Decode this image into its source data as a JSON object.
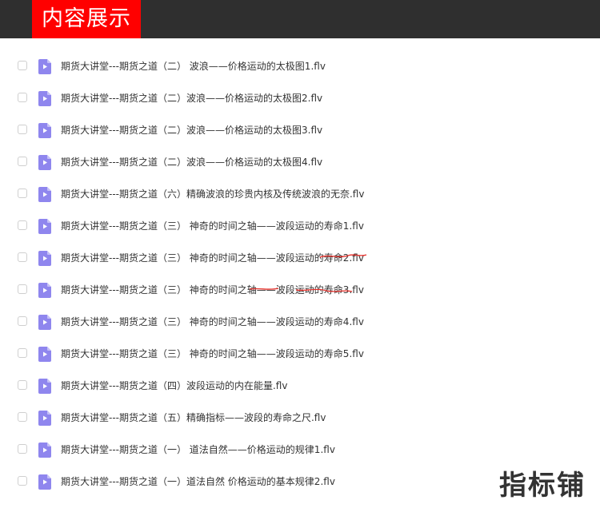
{
  "header": {
    "title": "内容展示"
  },
  "files": [
    {
      "name": "期货大讲堂---期货之道（二） 波浪——价格运动的太极图1.flv"
    },
    {
      "name": "期货大讲堂---期货之道（二）波浪——价格运动的太极图2.flv"
    },
    {
      "name": "期货大讲堂---期货之道（二）波浪——价格运动的太极图3.flv"
    },
    {
      "name": "期货大讲堂---期货之道（二）波浪——价格运动的太极图4.flv"
    },
    {
      "name": "期货大讲堂---期货之道（六）精确波浪的珍贵内核及传统波浪的无奈.flv"
    },
    {
      "name": "期货大讲堂---期货之道（三） 神奇的时间之轴——波段运动的寿命1.flv"
    },
    {
      "name": "期货大讲堂---期货之道（三） 神奇的时间之轴——波段运动的寿命2.flv"
    },
    {
      "name": "期货大讲堂---期货之道（三） 神奇的时间之轴——波段运动的寿命3.flv"
    },
    {
      "name": "期货大讲堂---期货之道（三） 神奇的时间之轴——波段运动的寿命4.flv"
    },
    {
      "name": "期货大讲堂---期货之道（三） 神奇的时间之轴——波段运动的寿命5.flv"
    },
    {
      "name": "期货大讲堂---期货之道（四）波段运动的内在能量.flv"
    },
    {
      "name": "期货大讲堂---期货之道（五）精确指标——波段的寿命之尺.flv"
    },
    {
      "name": "期货大讲堂---期货之道（一） 道法自然——价格运动的规律1.flv"
    },
    {
      "name": "期货大讲堂---期货之道（一）道法自然 价格运动的基本规律2.flv"
    }
  ],
  "watermark": {
    "text": "指标铺"
  },
  "colors": {
    "header_bg": "#2f2f2f",
    "header_tag_bg": "#ff0000",
    "icon_color": "#8f86ee",
    "text_color": "#333333"
  },
  "icons": {
    "file": "video-file-icon"
  }
}
